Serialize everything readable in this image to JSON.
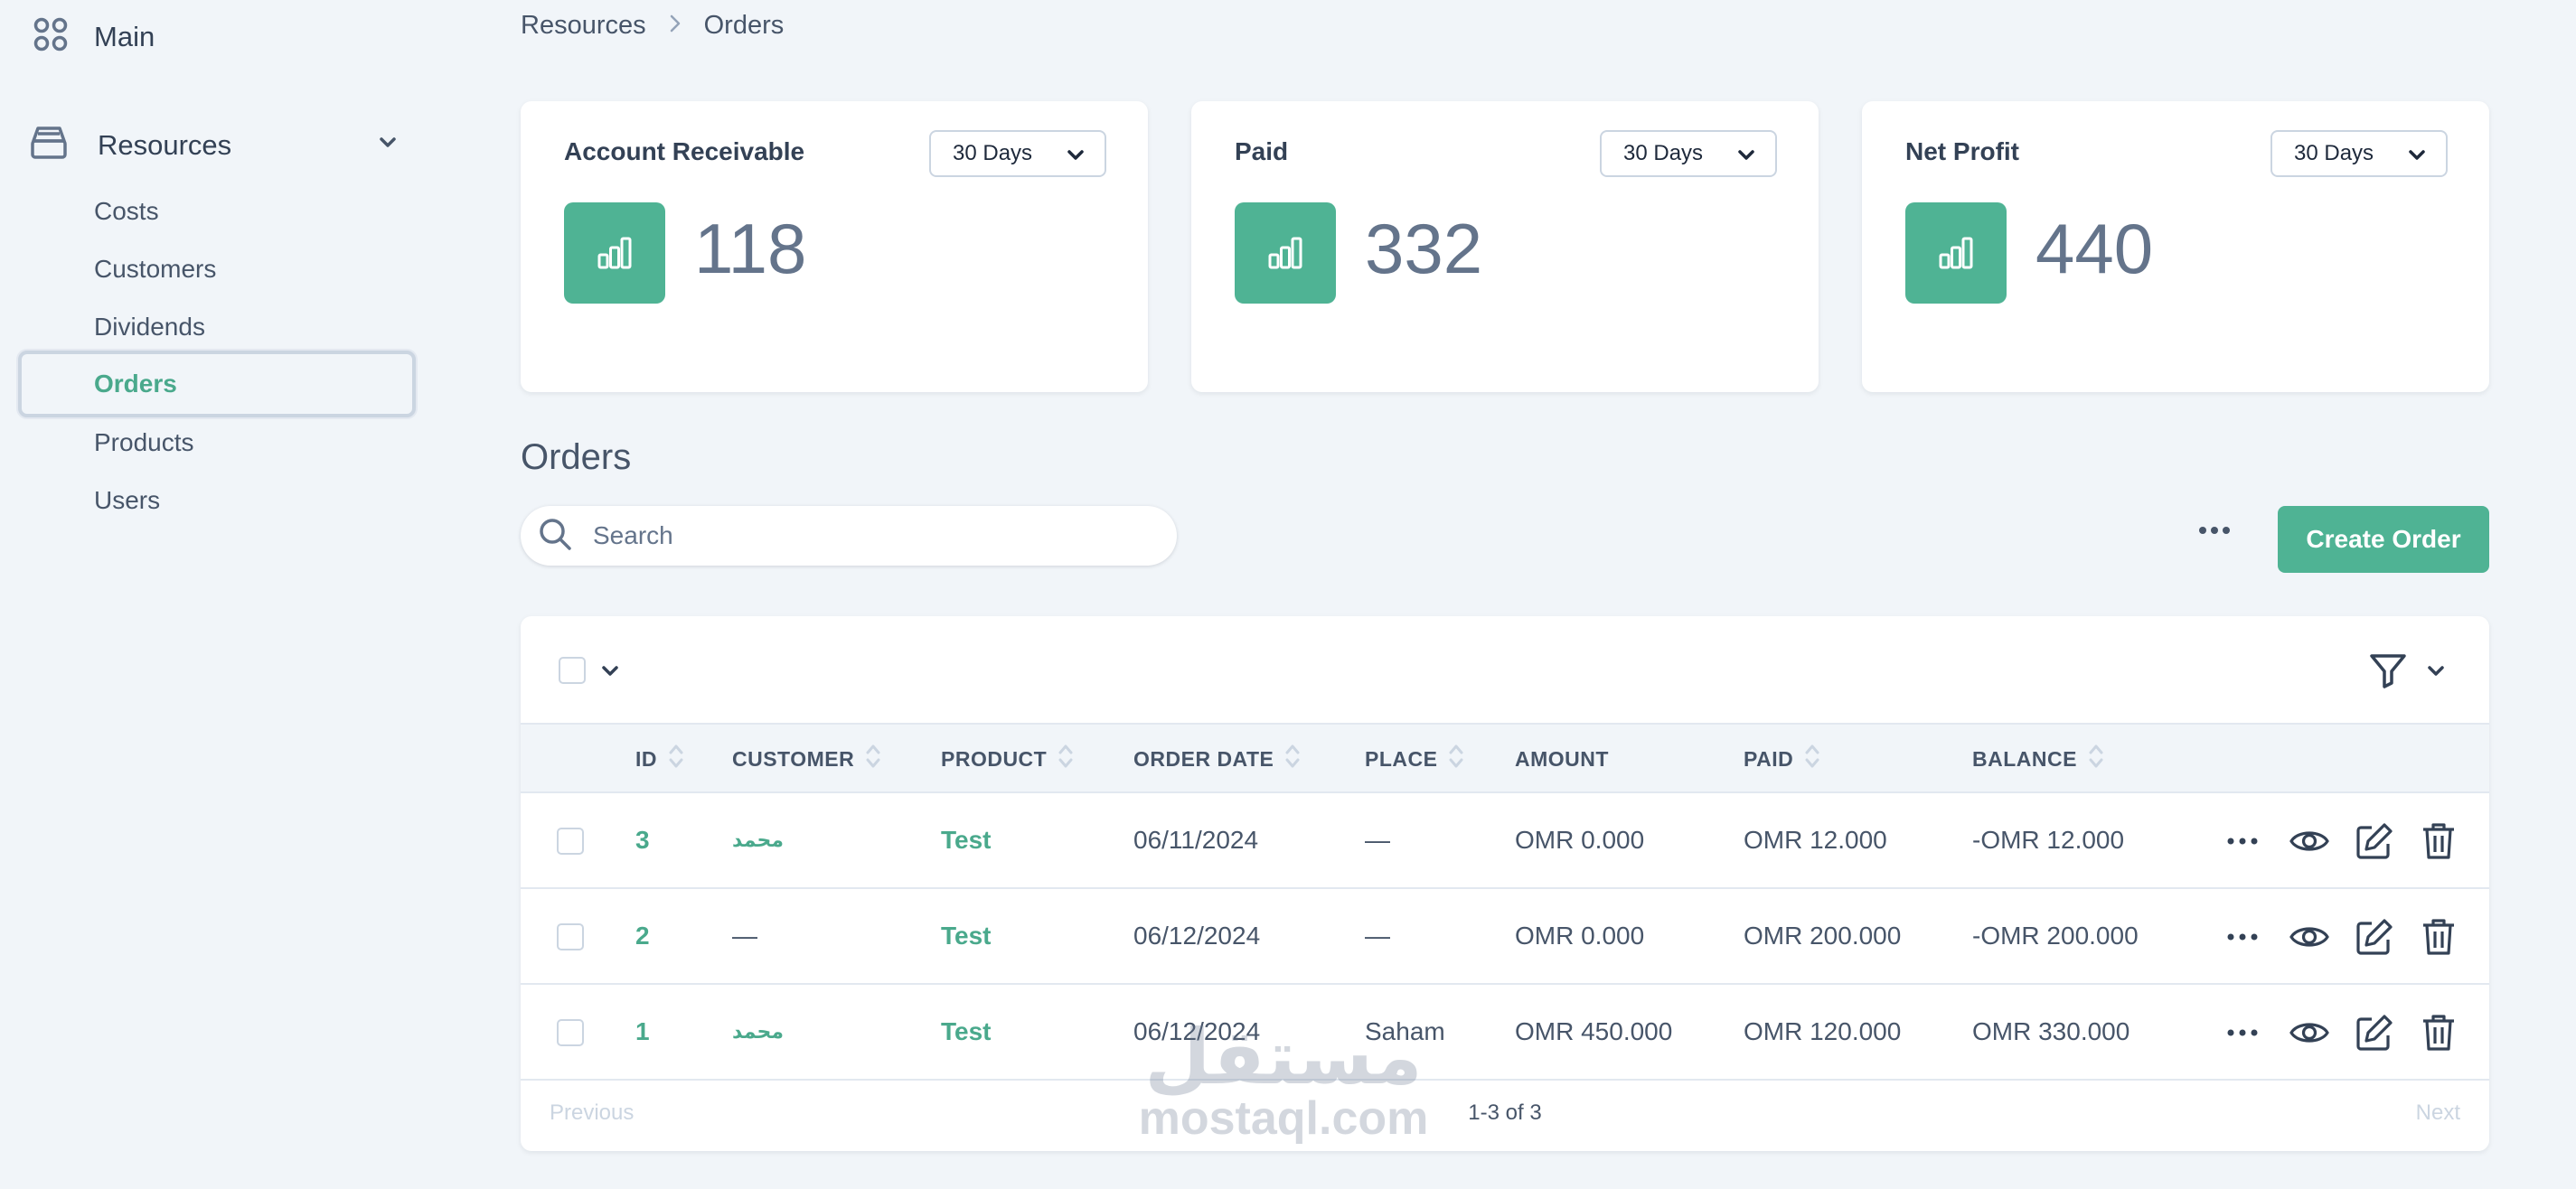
{
  "sidebar": {
    "main_label": "Main",
    "resources_label": "Resources",
    "items": [
      "Costs",
      "Customers",
      "Dividends",
      "Orders",
      "Products",
      "Users"
    ],
    "active_item": "Orders"
  },
  "breadcrumb": [
    "Resources",
    "Orders"
  ],
  "cards": [
    {
      "title": "Account Receivable",
      "range": "30 Days",
      "value": "118"
    },
    {
      "title": "Paid",
      "range": "30 Days",
      "value": "332"
    },
    {
      "title": "Net Profit",
      "range": "30 Days",
      "value": "440"
    }
  ],
  "orders": {
    "title": "Orders",
    "search_placeholder": "Search",
    "create_button": "Create Order"
  },
  "table": {
    "columns": [
      "ID",
      "CUSTOMER",
      "PRODUCT",
      "ORDER DATE",
      "PLACE",
      "AMOUNT",
      "PAID",
      "BALANCE"
    ],
    "rows": [
      {
        "id": "3",
        "customer": "محمد",
        "product": "Test",
        "order_date": "06/11/2024",
        "place": "—",
        "amount": "OMR 0.000",
        "paid": "OMR 12.000",
        "balance": "-OMR 12.000"
      },
      {
        "id": "2",
        "customer": "—",
        "product": "Test",
        "order_date": "06/12/2024",
        "place": "—",
        "amount": "OMR 0.000",
        "paid": "OMR 200.000",
        "balance": "-OMR 200.000"
      },
      {
        "id": "1",
        "customer": "محمد",
        "product": "Test",
        "order_date": "06/12/2024",
        "place": "Saham",
        "amount": "OMR 450.000",
        "paid": "OMR 120.000",
        "balance": "OMR 330.000"
      }
    ]
  },
  "pagination": {
    "previous": "Previous",
    "summary": "1-3 of 3",
    "next": "Next"
  },
  "watermark": {
    "logo_text": "مستقل",
    "text": "mostaql.com"
  },
  "colors": {
    "accent": "#4fb394",
    "link": "#4aa98c",
    "background": "#f1f5f9",
    "text": "#334155"
  }
}
